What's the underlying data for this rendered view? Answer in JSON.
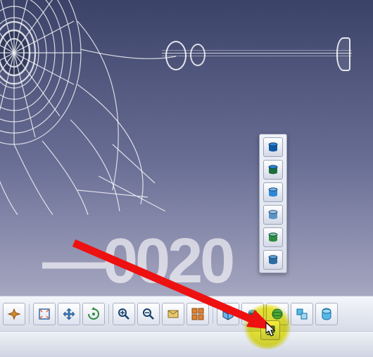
{
  "watermark": "—0020",
  "vertical_toolbar": [
    {
      "name": "shading-icon",
      "color_top": "#2e87d6",
      "color_bot": "#0f5aa3"
    },
    {
      "name": "shading-edges-icon",
      "color_top": "#2e87d6",
      "color_bot": "#1b6e3b"
    },
    {
      "name": "shading-no-edges-icon",
      "color_top": "#6fb5ea",
      "color_bot": "#2e87d6"
    },
    {
      "name": "shading-material-icon",
      "color_top": "#a9c9e8",
      "color_bot": "#5b93c7"
    },
    {
      "name": "wireframe-icon",
      "color_top": "#7dc98a",
      "color_bot": "#2e8b3d"
    },
    {
      "name": "customize-view-icon",
      "color_top": "#5fa3d8",
      "color_bot": "#2e6ba3"
    }
  ],
  "horizontal_toolbar": [
    {
      "name": "fly-mode-icon",
      "kind": "fly"
    },
    {
      "name": "fit-all-icon",
      "kind": "fit"
    },
    {
      "name": "pan-icon",
      "kind": "pan"
    },
    {
      "name": "rotate-icon",
      "kind": "rotate"
    },
    {
      "name": "zoom-in-icon",
      "kind": "zoomin"
    },
    {
      "name": "zoom-out-icon",
      "kind": "zoomout"
    },
    {
      "name": "normal-view-icon",
      "kind": "normal"
    },
    {
      "name": "multi-view-icon",
      "kind": "multi"
    },
    {
      "name": "iso-view-icon",
      "kind": "iso"
    },
    {
      "name": "render-style-icon",
      "kind": "render"
    },
    {
      "name": "hide-show-icon",
      "kind": "hideshow"
    },
    {
      "name": "swap-visible-icon",
      "kind": "swap"
    },
    {
      "name": "properties-icon",
      "kind": "props"
    }
  ],
  "highlighted_button": {
    "name": "view-mode-dropdown-icon"
  }
}
